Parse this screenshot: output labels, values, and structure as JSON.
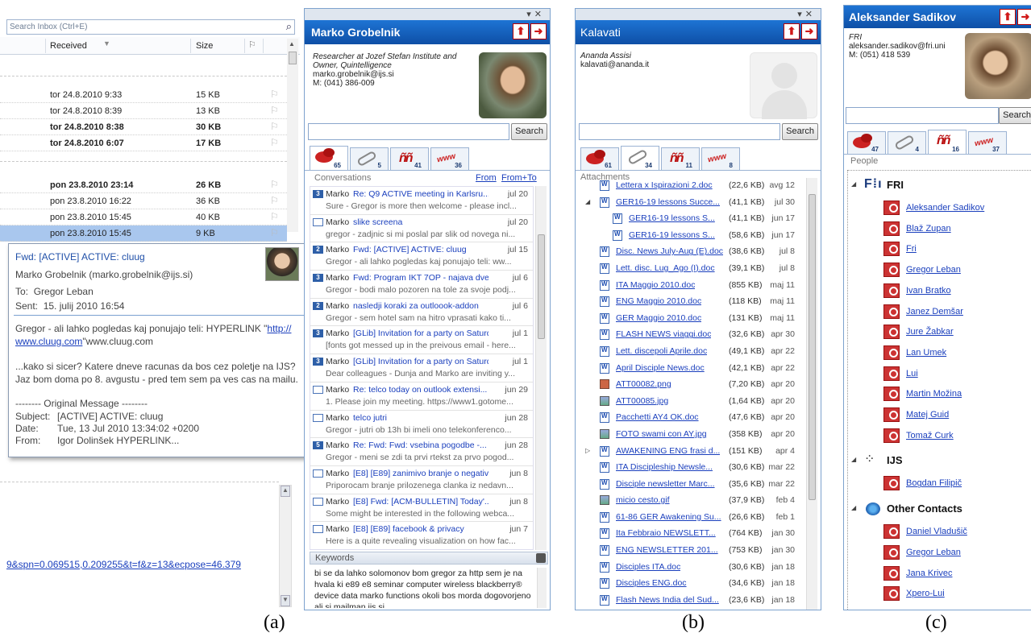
{
  "inbox": {
    "search_placeholder": "Search Inbox (Ctrl+E)",
    "col_received": "Received",
    "col_size": "Size",
    "rows": [
      {
        "date": "tor 24.8.2010 9:33",
        "size": "15 KB",
        "bold": false
      },
      {
        "date": "tor 24.8.2010 8:39",
        "size": "13 KB",
        "bold": false
      },
      {
        "date": "tor 24.8.2010 8:38",
        "size": "30 KB",
        "bold": true
      },
      {
        "date": "tor 24.8.2010 6:07",
        "size": "17 KB",
        "bold": true
      }
    ],
    "rows2": [
      {
        "date": "pon 23.8.2010 23:14",
        "size": "26 KB",
        "bold": true
      },
      {
        "date": "pon 23.8.2010 16:22",
        "size": "36 KB",
        "bold": false
      },
      {
        "date": "pon 23.8.2010 15:45",
        "size": "40 KB",
        "bold": false
      },
      {
        "date": "pon 23.8.2010 15:45",
        "size": "9 KB",
        "bold": false
      }
    ],
    "link_text": "9&spn=0.069515,0.209255&t=f&z=13&ecpose=46.379"
  },
  "popup": {
    "subject": "Fwd: [ACTIVE] ACTIVE: cluug",
    "from": "Marko Grobelnik (marko.grobelnik@ijs.si)",
    "to_label": "To:",
    "to": "Gregor Leban",
    "sent_label": "Sent:",
    "sent": "15. julij 2010 16:54",
    "body1_pre": "Gregor - ali lahko pogledas kaj ponujajo teli: HYPERLINK \"",
    "body1_link": "http://",
    "body1_link2": "www.cluug.com",
    "body1_post": "\"www.cluug.com",
    "body2": "...kako si sicer? Katere dneve racunas da bos cez poletje na IJS? Jaz bom doma po 8. avgustu - pred tem sem pa ves cas na mailu.",
    "orig": "-------- Original Message --------",
    "h_subject_l": "Subject:",
    "h_subject": "[ACTIVE] ACTIVE: cluug",
    "h_date_l": "Date:",
    "h_date": "Tue, 13 Jul 2010 13:34:02 +0200",
    "h_from_l": "From:",
    "h_from": "Igor Dolinšek HYPERLINK..."
  },
  "panelA": {
    "name": "Marko Grobelnik",
    "line1": "Researcher at Jozef Stefan Institute and",
    "line2": "Owner, Quintelligence",
    "email": "marko.grobelnik@ijs.si",
    "phone": "M: (041) 386-009",
    "search_btn": "Search",
    "tab_counts": [
      "65",
      "5",
      "41",
      "36"
    ],
    "conv_header": "Conversations",
    "from_link": "From",
    "fromto_link": "From+To",
    "conversations": [
      {
        "badge": "3",
        "sender": "Marko",
        "subject": "Re: Q9 ACTIVE meeting in Karlsru...",
        "date": "jul 20",
        "preview": "Sure - Gregor is more then welcome - please incl..."
      },
      {
        "badge": "",
        "sender": "Marko",
        "subject": "slike screena",
        "date": "jul 20",
        "preview": "gregor - zadjnic si mi poslal par slik od novega ni..."
      },
      {
        "badge": "2",
        "sender": "Marko",
        "subject": "Fwd: [ACTIVE] ACTIVE: cluug",
        "date": "jul 15",
        "preview": "Gregor - ali lahko pogledas kaj ponujajo teli: ww..."
      },
      {
        "badge": "3",
        "sender": "Marko",
        "subject": "Fwd: Program IKT 7OP - najava dve...",
        "date": "jul 6",
        "preview": "Gregor - bodi malo pozoren na tole za svoje podj..."
      },
      {
        "badge": "2",
        "sender": "Marko",
        "subject": "nasledji koraki za outloook-addon",
        "date": "jul 6",
        "preview": "Gregor - sem hotel sam na hitro vprasati kako ti..."
      },
      {
        "badge": "3",
        "sender": "Marko",
        "subject": "[GLib] Invitation for a party on Saturd...",
        "date": "jul 1",
        "preview": "[fonts got messed up in the preivous email - here..."
      },
      {
        "badge": "3",
        "sender": "Marko",
        "subject": "[GLib] Invitation for a party on Saturd...",
        "date": "jul 1",
        "preview": "Dear colleagues - Dunja and Marko are inviting y..."
      },
      {
        "badge": "",
        "sender": "Marko",
        "subject": "Re: telco today on outlook extensi...",
        "date": "jun 29",
        "preview": "1. Please join my meeting. https://www1.gotome..."
      },
      {
        "badge": "",
        "sender": "Marko",
        "subject": "telco jutri",
        "date": "jun 28",
        "preview": "Gregor - jutri ob 13h bi imeli ono telekonferenco..."
      },
      {
        "badge": "5",
        "sender": "Marko",
        "subject": "Re: Fwd: Fwd: vsebina pogodbe -...",
        "date": "jun 28",
        "preview": "Gregor - meni se zdi ta prvi rtekst za prvo pogod..."
      },
      {
        "badge": "",
        "sender": "Marko",
        "subject": "[E8] [E89] zanimivo branje o negativ...",
        "date": "jun 8",
        "preview": "Priporocam branje prilozenega clanka iz nedavn..."
      },
      {
        "badge": "",
        "sender": "Marko",
        "subject": "[E8] Fwd: [ACM-BULLETIN] Today'...",
        "date": "jun 8",
        "preview": "Some might be interested in the following webca..."
      },
      {
        "badge": "",
        "sender": "Marko",
        "subject": "[E8] [E89] facebook & privacy",
        "date": "jun 7",
        "preview": "Here is a quite revealing visualization on how fac..."
      }
    ],
    "keywords_header": "Keywords",
    "keywords": "bi se da lahko solomonov bom gregor za http sem je na hvala ki e89 e8 seminar computer wireless blackberry® device data marko functions okoli bos morda dogovorjeno ali si mailman.ijs.si"
  },
  "panelB": {
    "name": "Kalavati",
    "contact": "Ananda Assisi",
    "email": "kalavati@ananda.it",
    "search_btn": "Search",
    "tab_counts": [
      "61",
      "34",
      "11",
      "8"
    ],
    "header": "Attachments",
    "files": [
      {
        "indent": 0,
        "tw": "",
        "icon": "doc",
        "name": "Lettera x Ispirazioni 2.doc",
        "size": "(22,6 KB)",
        "date": "avg 12"
      },
      {
        "indent": 0,
        "tw": "◢",
        "icon": "doc",
        "name": "GER16-19 lessons Succe...",
        "size": "(41,1 KB)",
        "date": "jul 30"
      },
      {
        "indent": 1,
        "tw": "",
        "icon": "doc",
        "name": "GER16-19 lessons S...",
        "size": "(41,1 KB)",
        "date": "jun 17"
      },
      {
        "indent": 1,
        "tw": "",
        "icon": "doc",
        "name": "GER16-19 lessons S...",
        "size": "(58,6 KB)",
        "date": "jun 17"
      },
      {
        "indent": 0,
        "tw": "",
        "icon": "doc",
        "name": "Disc. News July-Aug (E).doc",
        "size": "(38,6 KB)",
        "date": "jul 8"
      },
      {
        "indent": 0,
        "tw": "",
        "icon": "doc",
        "name": "Lett. disc. Lug_Ago (I).doc",
        "size": "(39,1 KB)",
        "date": "jul 8"
      },
      {
        "indent": 0,
        "tw": "",
        "icon": "doc",
        "name": "ITA Maggio 2010.doc",
        "size": "(855 KB)",
        "date": "maj 11"
      },
      {
        "indent": 0,
        "tw": "",
        "icon": "doc",
        "name": "ENG Maggio 2010.doc",
        "size": "(118 KB)",
        "date": "maj 11"
      },
      {
        "indent": 0,
        "tw": "",
        "icon": "doc",
        "name": "GER Maggio 2010.doc",
        "size": "(131 KB)",
        "date": "maj 11"
      },
      {
        "indent": 0,
        "tw": "",
        "icon": "doc",
        "name": "FLASH NEWS viaggi.doc",
        "size": "(32,6 KB)",
        "date": "apr 30"
      },
      {
        "indent": 0,
        "tw": "",
        "icon": "doc",
        "name": "Lett. discepoli Aprile.doc",
        "size": "(49,1 KB)",
        "date": "apr 22"
      },
      {
        "indent": 0,
        "tw": "",
        "icon": "doc",
        "name": "April Disciple News.doc",
        "size": "(42,1 KB)",
        "date": "apr 22"
      },
      {
        "indent": 0,
        "tw": "",
        "icon": "png",
        "name": "ATT00082.png",
        "size": "(7,20 KB)",
        "date": "apr 20"
      },
      {
        "indent": 0,
        "tw": "",
        "icon": "img",
        "name": "ATT00085.jpg",
        "size": "(1,64 KB)",
        "date": "apr 20"
      },
      {
        "indent": 0,
        "tw": "",
        "icon": "doc",
        "name": "Pacchetti AY4 OK.doc",
        "size": "(47,6 KB)",
        "date": "apr 20"
      },
      {
        "indent": 0,
        "tw": "",
        "icon": "img",
        "name": "FOTO swami con AY.jpg",
        "size": "(358 KB)",
        "date": "apr 20"
      },
      {
        "indent": 0,
        "tw": "▷",
        "icon": "doc",
        "name": "AWAKENING ENG frasi d...",
        "size": "(151 KB)",
        "date": "apr 4"
      },
      {
        "indent": 0,
        "tw": "",
        "icon": "doc",
        "name": "ITA Discipleship Newsle...",
        "size": "(30,6 KB)",
        "date": "mar 22"
      },
      {
        "indent": 0,
        "tw": "",
        "icon": "doc",
        "name": "Disciple newsletter Marc...",
        "size": "(35,6 KB)",
        "date": "mar 22"
      },
      {
        "indent": 0,
        "tw": "",
        "icon": "img",
        "name": "micio cesto.gif",
        "size": "(37,9 KB)",
        "date": "feb 4"
      },
      {
        "indent": 0,
        "tw": "",
        "icon": "doc",
        "name": "61-86 GER Awakening Su...",
        "size": "(26,6 KB)",
        "date": "feb 1"
      },
      {
        "indent": 0,
        "tw": "",
        "icon": "doc",
        "name": "Ita Febbraio NEWSLETT...",
        "size": "(764 KB)",
        "date": "jan 30"
      },
      {
        "indent": 0,
        "tw": "",
        "icon": "doc",
        "name": "ENG NEWSLETTER 201...",
        "size": "(753 KB)",
        "date": "jan 30"
      },
      {
        "indent": 0,
        "tw": "",
        "icon": "doc",
        "name": "Disciples ITA.doc",
        "size": "(30,6 KB)",
        "date": "jan 18"
      },
      {
        "indent": 0,
        "tw": "",
        "icon": "doc",
        "name": "Disciples ENG.doc",
        "size": "(34,6 KB)",
        "date": "jan 18"
      },
      {
        "indent": 0,
        "tw": "",
        "icon": "doc",
        "name": "Flash News India del Sud...",
        "size": "(23,6 KB)",
        "date": "jan 18"
      }
    ]
  },
  "panelC": {
    "name": "Aleksander Sadikov",
    "org": "FRI",
    "email": "aleksander.sadikov@fri.uni",
    "phone": "M: (051) 418 539",
    "search_btn": "Search",
    "tab_counts": [
      "47",
      "4",
      "16",
      "37"
    ],
    "header": "People",
    "groups": [
      {
        "name": "FRI",
        "logo": "FRI",
        "members": [
          "Aleksander Sadikov",
          "Blaž Zupan",
          "Fri",
          "Gregor Leban",
          "Ivan Bratko",
          "Janez Demšar",
          "Jure Žabkar",
          "Lan Umek",
          "Lui",
          "Martin Možina",
          "Matej Guid",
          "Tomaž Curk"
        ]
      },
      {
        "name": "IJS",
        "logo": "IJS",
        "members": [
          "Bogdan Filipič"
        ]
      },
      {
        "name": "Other Contacts",
        "logo": "other",
        "members": [
          "Daniel Vladušič",
          "Gregor Leban",
          "Jana Krivec",
          "Xpero-Lui"
        ]
      }
    ]
  },
  "captions": {
    "a": "(a)",
    "b": "(b)",
    "c": "(c)"
  }
}
